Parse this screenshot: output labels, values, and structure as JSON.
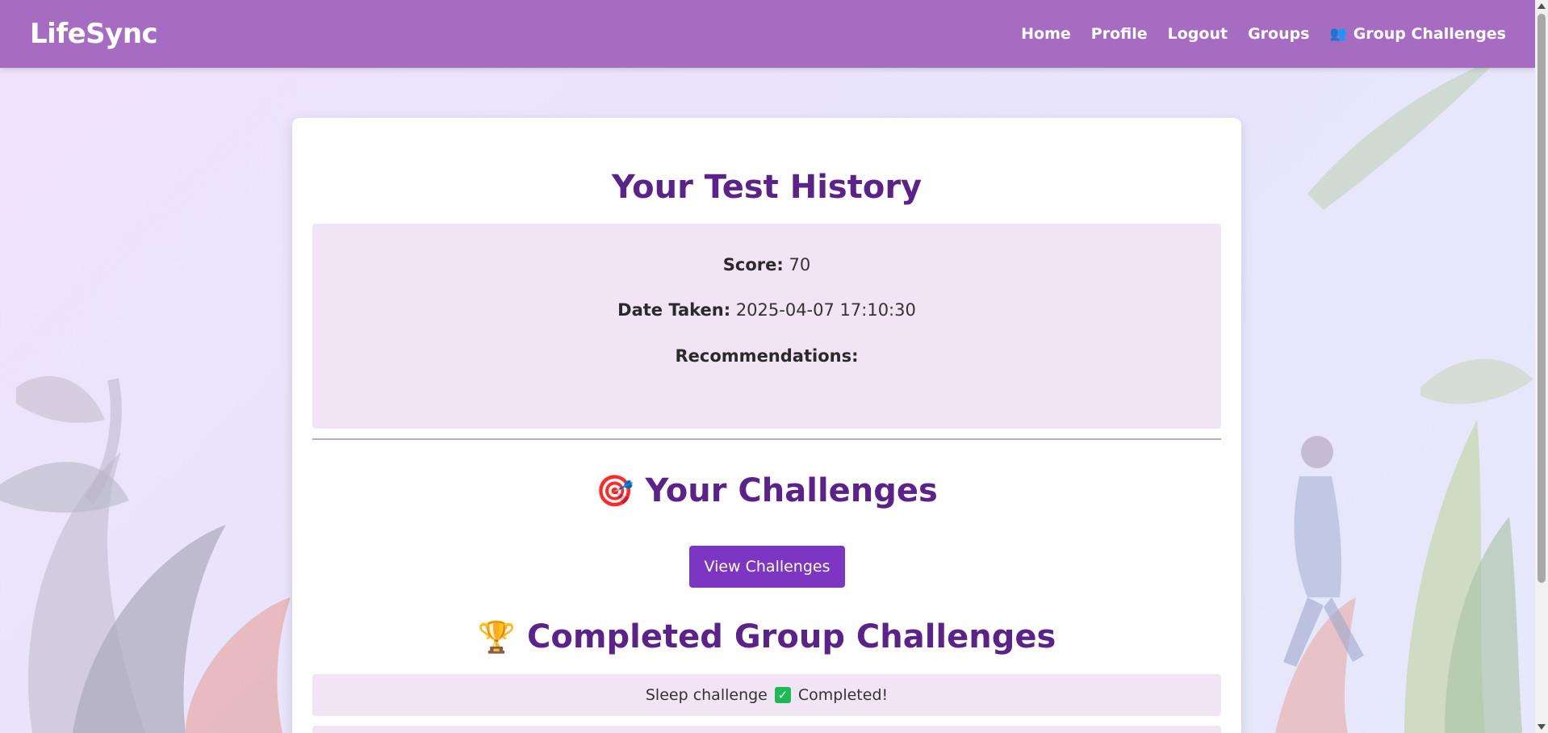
{
  "navbar": {
    "brand": "LifeSync",
    "links": [
      {
        "label": "Home"
      },
      {
        "label": "Profile"
      },
      {
        "label": "Logout"
      },
      {
        "label": "Groups"
      },
      {
        "label": "Group Challenges",
        "icon": "group-icon",
        "icon_glyph": "👥"
      }
    ],
    "color": "#a56cc1"
  },
  "history": {
    "title": "Your Test History",
    "score_label": "Score:",
    "score_value": "70",
    "date_label": "Date Taken:",
    "date_value": "2025-04-07 17:10:30",
    "recommendations_label": "Recommendations:"
  },
  "challenges": {
    "title": "Your Challenges",
    "icon": "target-icon",
    "icon_glyph": "🎯",
    "button_label": "View Challenges",
    "button_color": "#7d36c2"
  },
  "completed": {
    "title": "Completed Group Challenges",
    "icon": "trophy-icon",
    "icon_glyph": "🏆",
    "items": [
      {
        "name": "Sleep challenge",
        "status": "Completed!",
        "check_glyph": "✓"
      }
    ]
  },
  "colors": {
    "title": "#5b2289",
    "panel": "#f1e4f4"
  }
}
